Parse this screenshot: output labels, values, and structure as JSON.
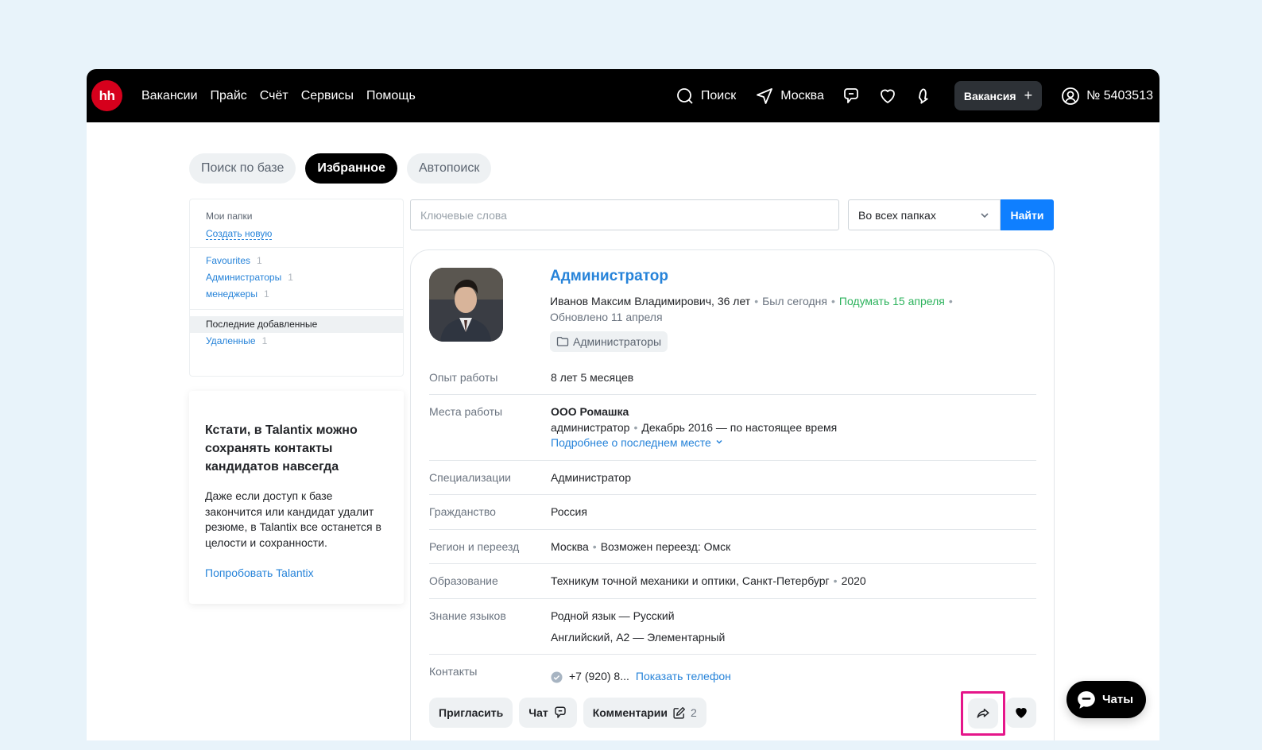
{
  "header": {
    "logo": "hh",
    "nav": [
      "Вакансии",
      "Прайс",
      "Счёт",
      "Сервисы",
      "Помощь"
    ],
    "search_label": "Поиск",
    "city": "Москва",
    "vacancy_button": "Вакансия",
    "account": "№ 5403513"
  },
  "tabs": [
    "Поиск по базе",
    "Избранное",
    "Автопоиск"
  ],
  "sidebar": {
    "my_folders": "Мои папки",
    "create_new": "Создать новую",
    "folders": [
      {
        "name": "Favourites",
        "count": "1"
      },
      {
        "name": "Администраторы",
        "count": "1"
      },
      {
        "name": "менеджеры",
        "count": "1"
      }
    ],
    "recent": "Последние добавленные",
    "deleted": {
      "name": "Удаленные",
      "count": "1"
    }
  },
  "promo": {
    "title": "Кстати, в Talantix можно сохранять контакты кандидатов навсегда",
    "text": "Даже если доступ к базе закончится или кандидат удалит резюме, в Talantix все останется в целости и сохранности.",
    "link": "Попробовать Talantix"
  },
  "search": {
    "placeholder": "Ключевые слова",
    "folder_select": "Во всех папках",
    "find_button": "Найти"
  },
  "candidate": {
    "position": "Администратор",
    "name_age": "Иванов Максим Владимирович, 36 лет",
    "last_seen": "Был сегодня",
    "reminder": "Подумать 15 апреля",
    "updated": "Обновлено 11 апреля",
    "folder_chip": "Администраторы",
    "experience_label": "Опыт работы",
    "experience": "8 лет 5 месяцев",
    "jobs_label": "Места работы",
    "company": "ООО Ромашка",
    "job_title": "администратор",
    "job_period": "Декабрь 2016 — по настоящее время",
    "job_more": "Подробнее о последнем месте",
    "spec_label": "Специализации",
    "spec": "Администратор",
    "citizenship_label": "Гражданство",
    "citizenship": "Россия",
    "region_label": "Регион и переезд",
    "region": "Москва",
    "relocation": "Возможен переезд: Омск",
    "education_label": "Образование",
    "education": "Техникум точной механики и оптики, Санкт-Петербург",
    "education_year": "2020",
    "languages_label": "Знание языков",
    "language_native": "Родной язык — Русский",
    "language_other": "Английский, A2 — Элементарный",
    "contacts_label": "Контакты",
    "phone": "+7 (920) 8...",
    "show_phone": "Показать телефон"
  },
  "actions": {
    "invite": "Пригласить",
    "chat": "Чат",
    "comments": "Комментарии",
    "comments_count": "2"
  },
  "chats_button": "Чаты",
  "colors": {
    "brand_red": "#d6001c",
    "link_blue": "#2683d9",
    "primary_button": "#0f7fff",
    "green": "#2db35d",
    "highlight_frame": "#e5168a"
  }
}
